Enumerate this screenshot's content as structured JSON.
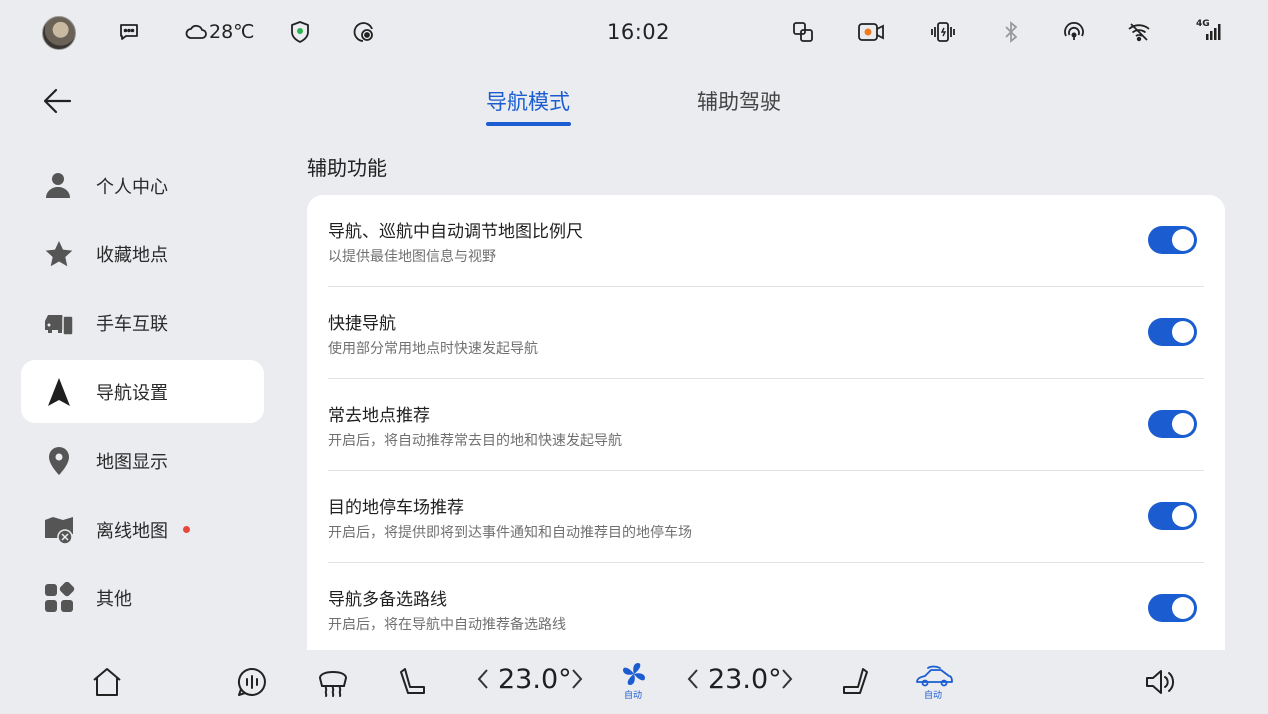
{
  "status_bar": {
    "weather_temp": "28℃",
    "clock": "16:02",
    "icons": [
      "avatar",
      "message-icon",
      "cloud-icon",
      "shield-icon",
      "location-target-icon",
      "screen-mirror-icon",
      "dashcam-icon",
      "phone-vibrate-icon",
      "bluetooth-icon",
      "hotspot-icon",
      "wifi-icon",
      "cellular-4g-icon"
    ],
    "network_label": "4G"
  },
  "tabs": [
    {
      "label": "导航模式",
      "active": true
    },
    {
      "label": "辅助驾驶",
      "active": false
    }
  ],
  "sidebar": {
    "items": [
      {
        "label": "个人中心",
        "icon": "person-icon"
      },
      {
        "label": "收藏地点",
        "icon": "star-icon"
      },
      {
        "label": "手车互联",
        "icon": "phone-car-icon"
      },
      {
        "label": "导航设置",
        "icon": "navigation-arrow-icon",
        "active": true
      },
      {
        "label": "地图显示",
        "icon": "map-pin-icon"
      },
      {
        "label": "离线地图",
        "icon": "offline-map-icon",
        "badge": true
      },
      {
        "label": "其他",
        "icon": "grid-icon"
      }
    ]
  },
  "section": {
    "title": "辅助功能",
    "rows": [
      {
        "title": "导航、巡航中自动调节地图比例尺",
        "subtitle": "以提供最佳地图信息与视野",
        "enabled": true
      },
      {
        "title": "快捷导航",
        "subtitle": "使用部分常用地点时快速发起导航",
        "enabled": true
      },
      {
        "title": "常去地点推荐",
        "subtitle": "开启后，将自动推荐常去目的地和快速发起导航",
        "enabled": true
      },
      {
        "title": "目的地停车场推荐",
        "subtitle": "开启后，将提供即将到达事件通知和自动推荐目的地停车场",
        "enabled": true
      },
      {
        "title": "导航多备选路线",
        "subtitle": "开启后，将在导航中自动推荐备选路线",
        "enabled": true
      }
    ]
  },
  "bottom_bar": {
    "temp_left": "23.0°",
    "temp_right": "23.0°",
    "fan_label": "自动",
    "car_label": "自动"
  },
  "colors": {
    "accent": "#1b5dd1",
    "background": "#ebecf0",
    "card": "#ffffff",
    "badge": "#e5483a"
  }
}
